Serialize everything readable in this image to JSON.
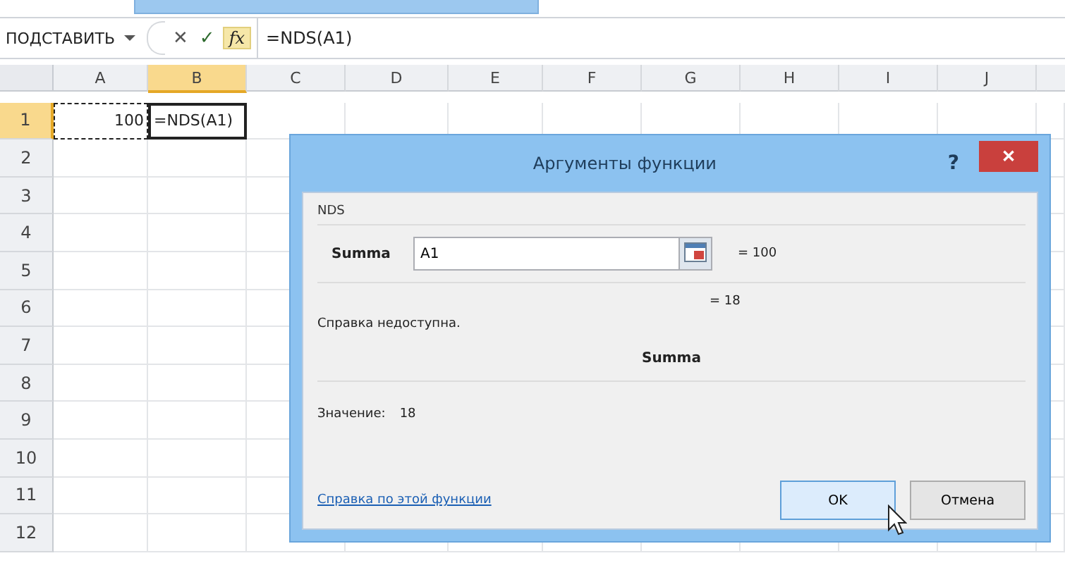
{
  "formula_bar": {
    "name_box": "ПОДСТАВИТЬ",
    "cancel_button": "✕",
    "enter_button": "✓",
    "function_button": "fx",
    "formula": "=NDS(A1)"
  },
  "columns": [
    {
      "label": "A",
      "selected": false
    },
    {
      "label": "B",
      "selected": true
    },
    {
      "label": "C",
      "selected": false
    },
    {
      "label": "D",
      "selected": false
    },
    {
      "label": "E",
      "selected": false
    },
    {
      "label": "F",
      "selected": false
    },
    {
      "label": "G",
      "selected": false
    },
    {
      "label": "H",
      "selected": false
    },
    {
      "label": "I",
      "selected": false
    },
    {
      "label": "J",
      "selected": false
    }
  ],
  "rows": [
    {
      "label": "1",
      "selected": true,
      "cells": [
        {
          "value": "100",
          "kind": "copied"
        },
        {
          "value": "=NDS(A1)",
          "kind": "active"
        }
      ]
    },
    {
      "label": "2",
      "selected": false
    },
    {
      "label": "3",
      "selected": false
    },
    {
      "label": "4",
      "selected": false
    },
    {
      "label": "5",
      "selected": false
    },
    {
      "label": "6",
      "selected": false
    },
    {
      "label": "7",
      "selected": false
    },
    {
      "label": "8",
      "selected": false
    },
    {
      "label": "9",
      "selected": false
    },
    {
      "label": "10",
      "selected": false
    },
    {
      "label": "11",
      "selected": false
    },
    {
      "label": "12",
      "selected": false
    }
  ],
  "dialog": {
    "title": "Аргументы функции",
    "help_button": "?",
    "close_button": "✕",
    "function_name": "NDS",
    "arguments": [
      {
        "label": "Summa",
        "value": "A1",
        "result": "= 100"
      }
    ],
    "result": "= 18",
    "help_text": "Справка недоступна.",
    "argument_name": "Summa",
    "value_label": "Значение:",
    "value": "18",
    "help_link": "Справка по этой функции",
    "buttons": [
      {
        "label": "OK",
        "default": true
      },
      {
        "label": "Отмена",
        "default": false
      }
    ]
  }
}
